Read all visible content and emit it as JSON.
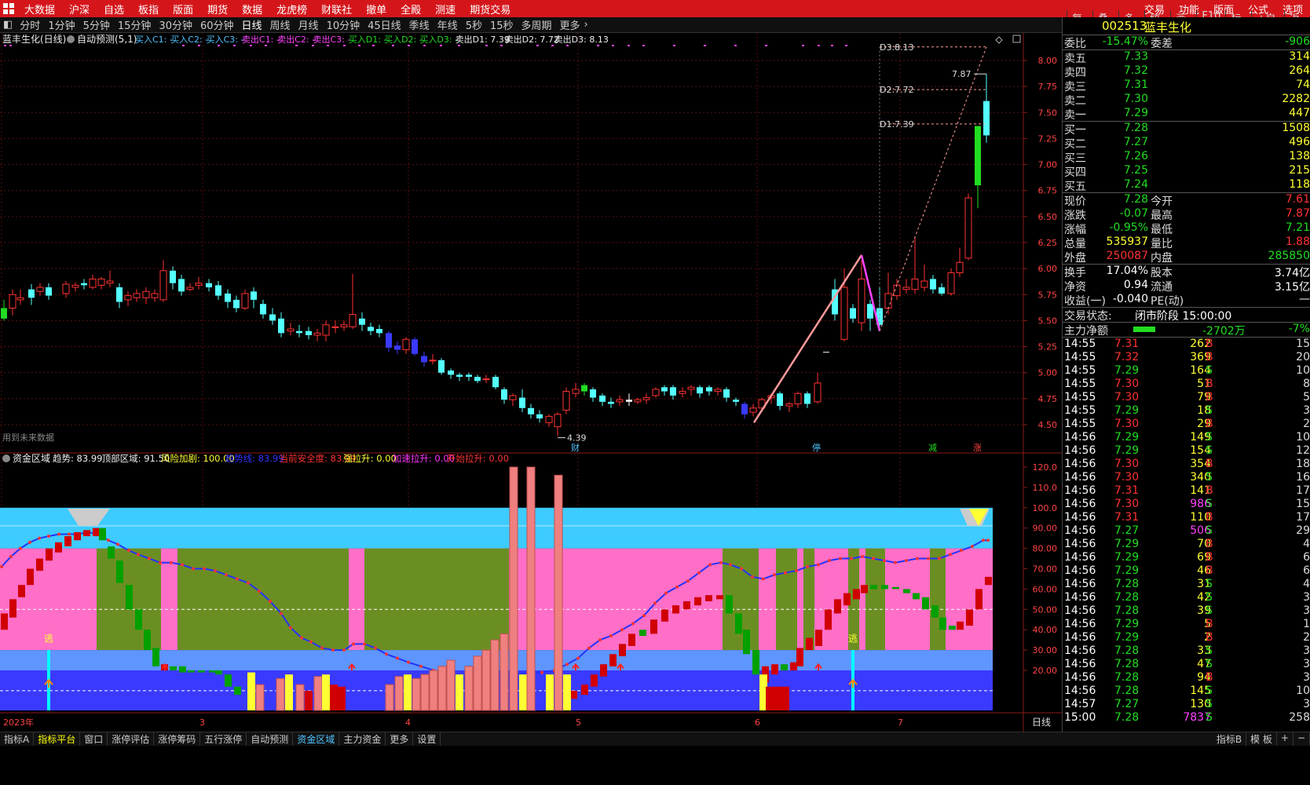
{
  "menubar": {
    "left": [
      "大数据",
      "沪深",
      "自选",
      "板指",
      "版面",
      "期货",
      "数据",
      "龙虎榜",
      "财联社",
      "撤单",
      "全殿",
      "测速",
      "期货交易"
    ],
    "right": [
      "交易",
      "功能",
      "版面",
      "公式",
      "选项"
    ]
  },
  "periods": [
    "分时",
    "1分钟",
    "5分钟",
    "15分钟",
    "30分钟",
    "60分钟",
    "日线",
    "周线",
    "月线",
    "10分钟",
    "45日线",
    "季线",
    "年线",
    "5秒",
    "15秒",
    "多周期",
    "更多"
  ],
  "active_period": "日线",
  "tools": [
    "复权",
    "叠加",
    "多股",
    "统计",
    "画线",
    "F10",
    "标记",
    "+自选",
    "返回"
  ],
  "main": {
    "title": "蓝丰生化(日线)",
    "indicator": "自动预测(5,1)",
    "signals": [
      {
        "t": "买入C1: -",
        "c": "#4fc3ff"
      },
      {
        "t": "买入C2: -",
        "c": "#4fc3ff"
      },
      {
        "t": "买入C3: -",
        "c": "#4fc3ff"
      },
      {
        "t": "卖出C1: -",
        "c": "#ff44ff"
      },
      {
        "t": "卖出C2: -",
        "c": "#ff44ff"
      },
      {
        "t": "卖出C3: -",
        "c": "#ff44ff"
      },
      {
        "t": "买入D1: -",
        "c": "#22dd22"
      },
      {
        "t": "买入D2: -",
        "c": "#22dd22"
      },
      {
        "t": "买入D3: -",
        "c": "#22dd22"
      },
      {
        "t": "卖出D1: 7.39",
        "c": "#eeeeee"
      },
      {
        "t": "卖出D2: 7.72",
        "c": "#eeeeee"
      },
      {
        "t": "卖出D3: 8.13",
        "c": "#eeeeee"
      }
    ],
    "y_ticks": [
      "8.00",
      "7.75",
      "7.50",
      "7.25",
      "7.00",
      "6.75",
      "6.50",
      "6.25",
      "6.00",
      "5.75",
      "5.50",
      "5.25",
      "5.00",
      "4.75",
      "4.50"
    ],
    "d_labels": [
      "D3:8.13",
      "D2:7.72",
      "D1:7.39"
    ],
    "high_label": "7.87",
    "low_label": "4.39",
    "footnote": "用到未来数据",
    "markers": [
      "财",
      "停",
      "减",
      "涨"
    ]
  },
  "sub": {
    "title": "资金区域",
    "values": [
      {
        "t": "趋势: 83.99",
        "c": "#eeeeee"
      },
      {
        "t": "顶部区域: 91.50",
        "c": "#eeeeee"
      },
      {
        "t": "风险加剧: 100.00",
        "c": "#ffff33"
      },
      {
        "t": "趋势线: 83.99",
        "c": "#3333ff"
      },
      {
        "t": "当前安全度: 83.99",
        "c": "#ff3333"
      },
      {
        "t": "强拉升: 0.00",
        "c": "#ffff33"
      },
      {
        "t": "加速拉升: 0.00",
        "c": "#ff33ff"
      },
      {
        "t": "开始拉升: 0.00",
        "c": "#ff3333"
      }
    ],
    "y_ticks": [
      "120.0",
      "110.0",
      "100.0",
      "90.00",
      "80.00",
      "70.00",
      "60.00",
      "50.00",
      "40.00",
      "30.00",
      "20.00"
    ],
    "escape": "逃"
  },
  "xaxis": [
    "2023年",
    "3",
    "4",
    "5",
    "6",
    "7"
  ],
  "xaxis_right": "日线",
  "quote": {
    "code": "002513",
    "name": "蓝丰生化",
    "weibi_label": "委比",
    "weibi": "-15.47%",
    "weicha_label": "委差",
    "weicha": "-906",
    "asks": [
      [
        "卖五",
        "7.33",
        "314"
      ],
      [
        "卖四",
        "7.32",
        "264"
      ],
      [
        "卖三",
        "7.31",
        "74"
      ],
      [
        "卖二",
        "7.30",
        "2282"
      ],
      [
        "卖一",
        "7.29",
        "447"
      ]
    ],
    "bids": [
      [
        "买一",
        "7.28",
        "1508"
      ],
      [
        "买二",
        "7.27",
        "496"
      ],
      [
        "买三",
        "7.26",
        "138"
      ],
      [
        "买四",
        "7.25",
        "215"
      ],
      [
        "买五",
        "7.24",
        "118"
      ]
    ],
    "stats": [
      [
        "现价",
        "7.28",
        "今开",
        "7.61"
      ],
      [
        "涨跌",
        "-0.07",
        "最高",
        "7.87"
      ],
      [
        "涨幅",
        "-0.95%",
        "最低",
        "7.21"
      ],
      [
        "总量",
        "535937",
        "量比",
        "1.88"
      ],
      [
        "外盘",
        "250087",
        "内盘",
        "285850"
      ]
    ],
    "stats2": [
      [
        "换手",
        "17.04%",
        "股本",
        "3.74亿"
      ],
      [
        "净资",
        "0.94",
        "流通",
        "3.15亿"
      ],
      [
        "收益(一)",
        "-0.040",
        "PE(动)",
        "—"
      ]
    ],
    "status_label": "交易状态:",
    "status": "闭市阶段 15:00:00",
    "net_label": "主力净额",
    "net": "-2702万",
    "net_pct": "-7%",
    "ticks": [
      [
        "14:55",
        "7.31",
        "262",
        "B",
        "15"
      ],
      [
        "14:55",
        "7.32",
        "369",
        "B",
        "20"
      ],
      [
        "14:55",
        "7.29",
        "164",
        "S",
        "10"
      ],
      [
        "14:55",
        "7.30",
        "51",
        "B",
        "8"
      ],
      [
        "14:55",
        "7.30",
        "79",
        "B",
        "5"
      ],
      [
        "14:55",
        "7.29",
        "18",
        "S",
        "3"
      ],
      [
        "14:55",
        "7.30",
        "29",
        "B",
        "2"
      ],
      [
        "14:56",
        "7.29",
        "149",
        "S",
        "10"
      ],
      [
        "14:56",
        "7.29",
        "154",
        "S",
        "12"
      ],
      [
        "14:56",
        "7.30",
        "354",
        "B",
        "18"
      ],
      [
        "14:56",
        "7.30",
        "340",
        "S",
        "16"
      ],
      [
        "14:56",
        "7.31",
        "141",
        "B",
        "17"
      ],
      [
        "14:56",
        "7.30",
        "986",
        "S",
        "15"
      ],
      [
        "14:56",
        "7.31",
        "110",
        "B",
        "17"
      ],
      [
        "14:56",
        "7.27",
        "506",
        "S",
        "29"
      ],
      [
        "14:56",
        "7.29",
        "70",
        "B",
        "4"
      ],
      [
        "14:56",
        "7.29",
        "69",
        "B",
        "6"
      ],
      [
        "14:56",
        "7.29",
        "46",
        "B",
        "6"
      ],
      [
        "14:56",
        "7.28",
        "31",
        "S",
        "4"
      ],
      [
        "14:56",
        "7.28",
        "42",
        "S",
        "3"
      ],
      [
        "14:56",
        "7.28",
        "39",
        "S",
        "3"
      ],
      [
        "14:56",
        "7.29",
        "5",
        "B",
        "1"
      ],
      [
        "14:56",
        "7.29",
        "2",
        "B",
        "2"
      ],
      [
        "14:56",
        "7.28",
        "33",
        "S",
        "3"
      ],
      [
        "14:56",
        "7.28",
        "47",
        "S",
        "3"
      ],
      [
        "14:56",
        "7.28",
        "94",
        "B",
        "3"
      ],
      [
        "14:56",
        "7.28",
        "145",
        "S",
        "10"
      ],
      [
        "14:57",
        "7.27",
        "130",
        "S",
        "3"
      ],
      [
        "15:00",
        "7.28",
        "7837",
        "S",
        "258"
      ]
    ]
  },
  "bottom": {
    "tabs": [
      "指标A",
      "指标平台",
      "窗口",
      "涨停评估",
      "涨停筹码",
      "五行涨停",
      "自动预测",
      "资金区域",
      "主力资金",
      "更多",
      "设置"
    ],
    "right": [
      "指标B",
      "模 板",
      "+",
      "−"
    ]
  },
  "colors": {
    "up": "#ff3232",
    "down": "#54ffff",
    "green": "#22dd22",
    "yellow": "#ffff33",
    "pink": "#ff6ec7",
    "olive": "#6b8e23",
    "sky": "#40d0ff",
    "blue": "#3a3aff"
  }
}
